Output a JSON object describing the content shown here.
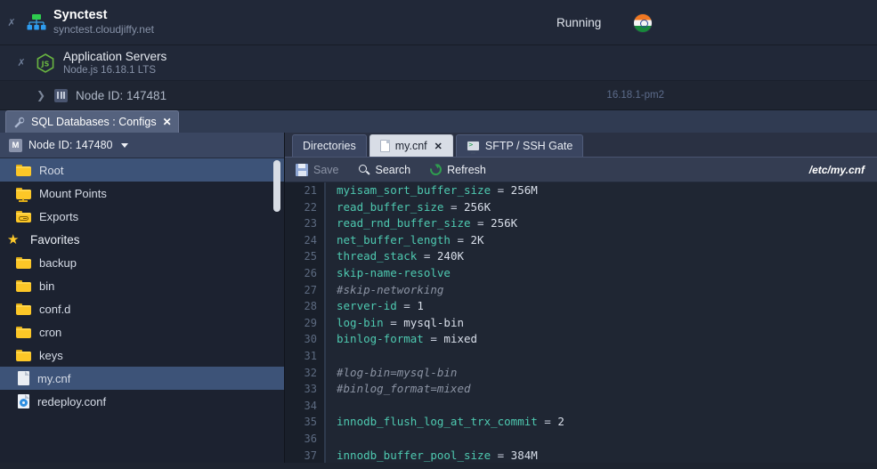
{
  "env_header": {
    "name": "Synctest",
    "domain": "synctest.cloudjiffy.net",
    "status": "Running",
    "icon": "environment-topology-icon",
    "flag_icon": "india-flag-icon"
  },
  "layer": {
    "name": "Application Servers",
    "sub": "Node.js 16.18.1 LTS",
    "icon": "nodejs-icon"
  },
  "node": {
    "label": "Node ID: 147481",
    "version": "16.18.1-pm2"
  },
  "app_tab": {
    "label": "SQL Databases : Configs",
    "close": "✕",
    "icon": "wrench-icon"
  },
  "file_panel": {
    "node_select": {
      "badge": "M",
      "label": "Node ID: 147480"
    },
    "tree": [
      {
        "label": "Root",
        "type": "folder",
        "selected": true,
        "indent": 1
      },
      {
        "label": "Mount Points",
        "type": "folder-mount",
        "selected": false,
        "indent": 1
      },
      {
        "label": "Exports",
        "type": "folder-export",
        "selected": false,
        "indent": 1
      },
      {
        "label": "Favorites",
        "type": "star",
        "selected": false,
        "indent": 0
      },
      {
        "label": "backup",
        "type": "folder",
        "selected": false,
        "indent": 1
      },
      {
        "label": "bin",
        "type": "folder",
        "selected": false,
        "indent": 1
      },
      {
        "label": "conf.d",
        "type": "folder",
        "selected": false,
        "indent": 1
      },
      {
        "label": "cron",
        "type": "folder",
        "selected": false,
        "indent": 1
      },
      {
        "label": "keys",
        "type": "folder",
        "selected": false,
        "indent": 1
      },
      {
        "label": "my.cnf",
        "type": "file",
        "selected": true,
        "indent": 1
      },
      {
        "label": "redeploy.conf",
        "type": "file-conf",
        "selected": false,
        "indent": 1
      }
    ]
  },
  "editor": {
    "tabs": [
      {
        "label": "Directories",
        "icon": "",
        "active": false,
        "closable": false
      },
      {
        "label": "my.cnf",
        "icon": "document-icon",
        "active": true,
        "closable": true
      },
      {
        "label": "SFTP / SSH Gate",
        "icon": "terminal-monitor-icon",
        "active": false,
        "closable": false
      }
    ],
    "toolbar": {
      "save": "Save",
      "save_disabled": true,
      "search": "Search",
      "refresh": "Refresh",
      "path": "/etc/my.cnf"
    },
    "first_line_number": 21,
    "lines": [
      {
        "n": 21,
        "tokens": [
          {
            "t": "myisam_sort_buffer_size",
            "c": "k"
          },
          {
            "t": " = ",
            "c": "op"
          },
          {
            "t": "256M",
            "c": "v"
          }
        ]
      },
      {
        "n": 22,
        "tokens": [
          {
            "t": "read_buffer_size",
            "c": "k"
          },
          {
            "t": " = ",
            "c": "op"
          },
          {
            "t": "256K",
            "c": "v"
          }
        ]
      },
      {
        "n": 23,
        "tokens": [
          {
            "t": "read_rnd_buffer_size",
            "c": "k"
          },
          {
            "t": " = ",
            "c": "op"
          },
          {
            "t": "256K",
            "c": "v"
          }
        ]
      },
      {
        "n": 24,
        "tokens": [
          {
            "t": "net_buffer_length",
            "c": "k"
          },
          {
            "t": " = ",
            "c": "op"
          },
          {
            "t": "2K",
            "c": "v"
          }
        ]
      },
      {
        "n": 25,
        "tokens": [
          {
            "t": "thread_stack",
            "c": "k"
          },
          {
            "t": " = ",
            "c": "op"
          },
          {
            "t": "240K",
            "c": "v"
          }
        ]
      },
      {
        "n": 26,
        "tokens": [
          {
            "t": "skip-name-resolve",
            "c": "k"
          }
        ]
      },
      {
        "n": 27,
        "tokens": [
          {
            "t": "#skip-networking",
            "c": "cm"
          }
        ]
      },
      {
        "n": 28,
        "tokens": [
          {
            "t": "server-id",
            "c": "k"
          },
          {
            "t": " = ",
            "c": "op"
          },
          {
            "t": "1",
            "c": "v"
          }
        ]
      },
      {
        "n": 29,
        "tokens": [
          {
            "t": "log-bin",
            "c": "k"
          },
          {
            "t": " = ",
            "c": "op"
          },
          {
            "t": "mysql-bin",
            "c": "v"
          }
        ]
      },
      {
        "n": 30,
        "tokens": [
          {
            "t": "binlog-format",
            "c": "k"
          },
          {
            "t": " = ",
            "c": "op"
          },
          {
            "t": "mixed",
            "c": "v"
          }
        ]
      },
      {
        "n": 31,
        "tokens": []
      },
      {
        "n": 32,
        "tokens": [
          {
            "t": "#log-bin=mysql-bin",
            "c": "cm"
          }
        ]
      },
      {
        "n": 33,
        "tokens": [
          {
            "t": "#binlog_format=mixed",
            "c": "cm"
          }
        ]
      },
      {
        "n": 34,
        "tokens": []
      },
      {
        "n": 35,
        "tokens": [
          {
            "t": "innodb_flush_log_at_trx_commit",
            "c": "k"
          },
          {
            "t": " = ",
            "c": "op"
          },
          {
            "t": "2",
            "c": "v"
          }
        ]
      },
      {
        "n": 36,
        "tokens": []
      },
      {
        "n": 37,
        "tokens": [
          {
            "t": "innodb_buffer_pool_size",
            "c": "k"
          },
          {
            "t": " = ",
            "c": "op"
          },
          {
            "t": "384M",
            "c": "v"
          }
        ]
      }
    ]
  },
  "colors": {
    "accent_green": "#2f9e4f",
    "folder_yellow": "#fcc727",
    "selection_blue": "#3d5378",
    "code_key": "#4ec9b0",
    "code_comment": "#8b93a3"
  }
}
